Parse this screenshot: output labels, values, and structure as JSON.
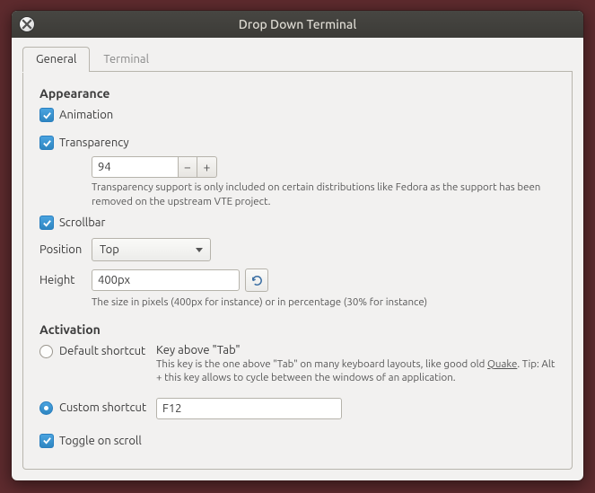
{
  "window": {
    "title": "Drop Down Terminal"
  },
  "tabs": {
    "general": "General",
    "terminal": "Terminal"
  },
  "appearance": {
    "title": "Appearance",
    "animation": "Animation",
    "transparency": "Transparency",
    "transparency_value": "94",
    "transparency_hint": "Transparency support is only included on certain distributions like Fedora as the support has been removed on the upstream VTE project.",
    "scrollbar": "Scrollbar",
    "position_label": "Position",
    "position_value": "Top",
    "height_label": "Height",
    "height_value": "400px",
    "height_hint": "The size in pixels (400px for instance) or in percentage (30% for instance)"
  },
  "activation": {
    "title": "Activation",
    "default_label": "Default shortcut",
    "default_key": "Key above \"Tab\"",
    "default_hint_a": "This key is the one above \"Tab\" on many keyboard layouts, like good old ",
    "default_hint_link": "Quake",
    "default_hint_b": ". Tip: Alt + this key allows to cycle between the windows of an application.",
    "custom_label": "Custom shortcut",
    "custom_value": "F12",
    "toggle_scroll": "Toggle on scroll"
  }
}
